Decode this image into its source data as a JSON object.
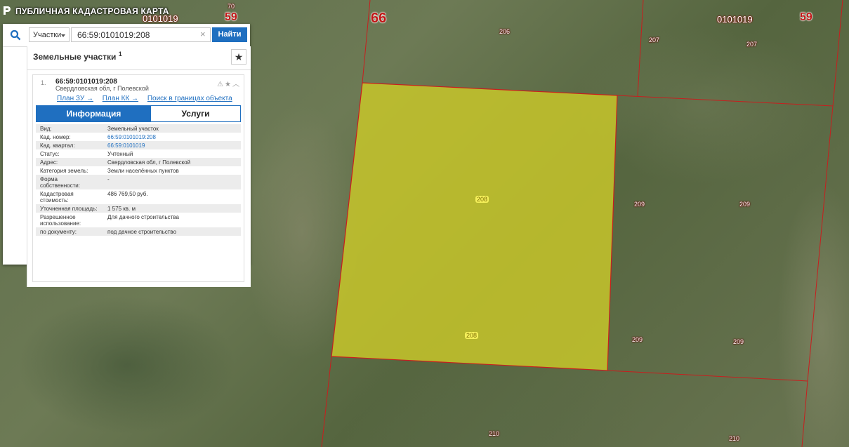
{
  "header": {
    "title": "ПУБЛИЧНАЯ КАДАСТРОВАЯ КАРТА"
  },
  "search": {
    "type_label": "Участки",
    "query": "66:59:0101019:208",
    "find_label": "Найти"
  },
  "results": {
    "heading": "Земельные участки",
    "count": "1",
    "item": {
      "num": "1.",
      "code": "66:59:0101019:208",
      "address": "Свердловская обл, г Полевской",
      "links": [
        "План ЗУ →",
        "План КК →",
        "Поиск в границах объекта →"
      ],
      "tabs": [
        "Информация",
        "Услуги"
      ],
      "props": [
        {
          "k": "Вид:",
          "v": "Земельный участок"
        },
        {
          "k": "Кад. номер:",
          "v": "66:59:0101019:208"
        },
        {
          "k": "Кад. квартал:",
          "v": "66:59:0101019"
        },
        {
          "k": "Статус:",
          "v": "Учтенный"
        },
        {
          "k": "Адрес:",
          "v": "Свердловская обл, г Полевской"
        },
        {
          "k": "Категория земель:",
          "v": "Земли населённых пунктов"
        },
        {
          "k": "Форма собственности:",
          "v": "-"
        },
        {
          "k": "Кадастровая стоимость:",
          "v": "486 769,50 руб."
        },
        {
          "k": "Уточненная площадь:",
          "v": "1 575 кв. м"
        },
        {
          "k": "Разрешенное использование:",
          "v": "Для дачного строительства"
        },
        {
          "k": "по документу:",
          "v": "под дачное строительство"
        }
      ]
    }
  },
  "map_labels": {
    "region_66": "66",
    "district_59_left": "59",
    "district_59_right": "59",
    "quarter_left": "0101019",
    "quarter_right": "0101019",
    "top_70": "70",
    "p206": "206",
    "p207a": "207",
    "p207b": "207",
    "p208a": "208",
    "p208b": "208",
    "p209a": "209",
    "p209b": "209",
    "p209c": "209",
    "p209d": "209",
    "p210a": "210",
    "p210b": "210"
  },
  "colors": {
    "accent": "#1f6fc0",
    "selected_parcel": "#c7c62a",
    "boundary": "#c81e1e"
  }
}
